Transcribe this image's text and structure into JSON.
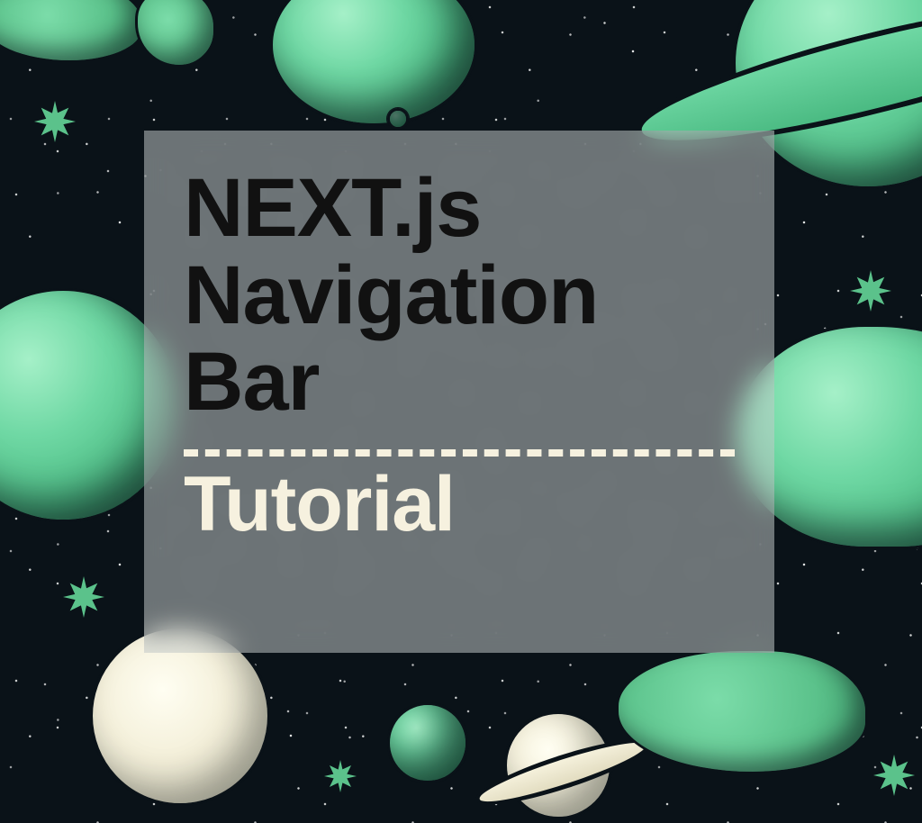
{
  "card": {
    "title_line1": "NEXT.js",
    "title_line2": "Navigation",
    "title_line3": "Bar",
    "subtitle": "Tutorial"
  },
  "colors": {
    "space_bg": "#0a1218",
    "planet_green": "#6fd8a4",
    "planet_cream": "#f5f1dc",
    "card_glass": "rgba(200,205,205,0.52)",
    "title_text": "#111",
    "subtitle_text": "#f6f1df",
    "divider": "#f6f1df"
  }
}
